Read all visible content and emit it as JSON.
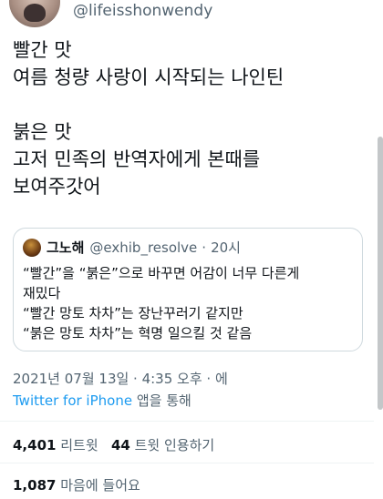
{
  "author": {
    "handle": "@lifeisshonwendy"
  },
  "tweet": {
    "line1": "빨간 맛",
    "line2": "여름 청량 사랑이 시작되는 나인틴",
    "line3": "붉은 맛",
    "line4": "고저 민족의 반역자에게 본때를",
    "line5": "보여주갓어"
  },
  "quote": {
    "name": "그노해",
    "handle": "@exhib_resolve",
    "separator": "·",
    "time": "20시",
    "line1": "“빨간”을 “붉은”으로 바꾸면 어감이 너무 다른게",
    "line2": "재밌다",
    "line3": "“빨간 망토 차차”는 장난꾸러기 같지만",
    "line4": "“붉은 망토 차차”는 혁명 일으킬 것 같음"
  },
  "meta": {
    "datetime": "2021년 07월 13일 · 4:35 오후 · 에",
    "source": "Twitter for iPhone",
    "source_suffix": " 앱을 통해"
  },
  "stats": {
    "retweets_count": "4,401",
    "retweets_label": "리트윗",
    "quotes_count": "44",
    "quotes_label": "트윗 인용하기",
    "likes_count": "1,087",
    "likes_label": "마음에 들어요"
  },
  "colors": {
    "link": "#1d9bf0",
    "muted": "#536471",
    "text": "#0f1419"
  }
}
